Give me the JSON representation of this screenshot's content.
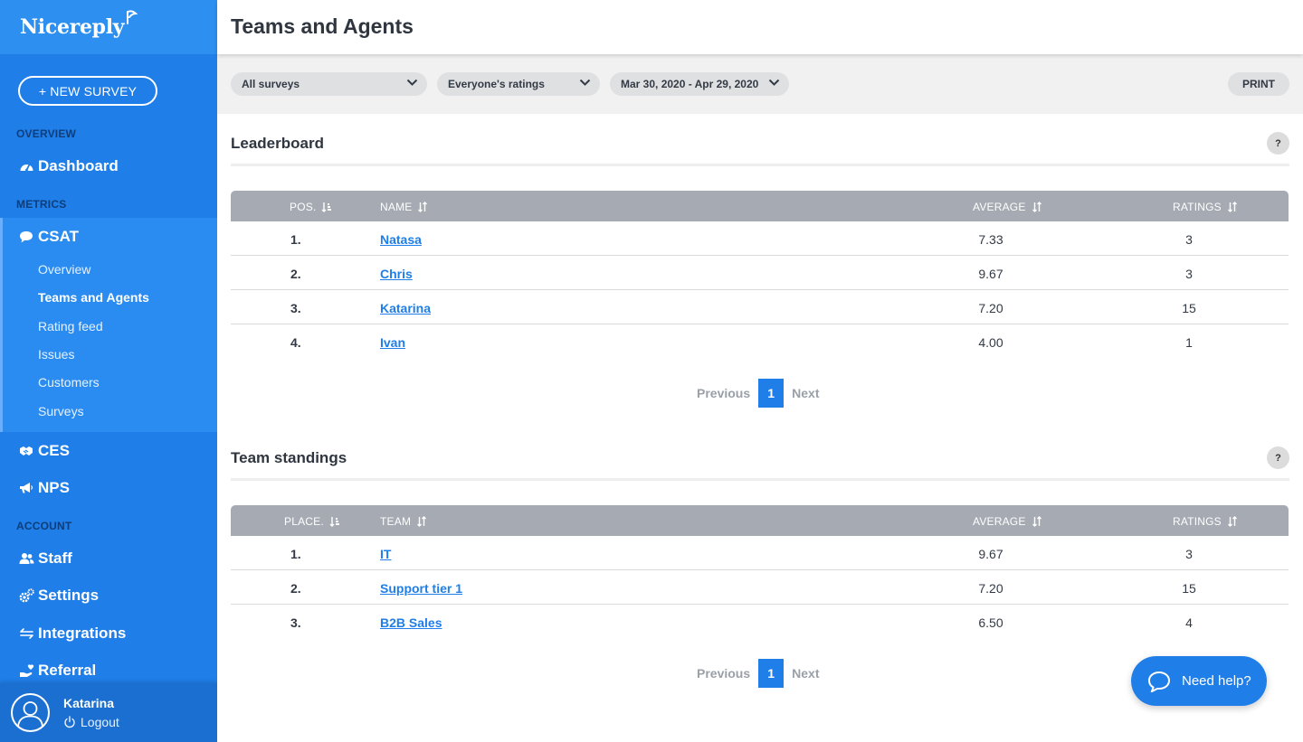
{
  "brand": {
    "name": "Nicereply"
  },
  "sidebar": {
    "new_survey_label": "+ NEW SURVEY",
    "overview_label": "OVERVIEW",
    "metrics_label": "METRICS",
    "account_label": "ACCOUNT",
    "dashboard": {
      "label": "Dashboard",
      "icon": "gauge-icon"
    },
    "csat": {
      "label": "CSAT",
      "icon": "chat-bubble-icon"
    },
    "csat_items": [
      {
        "label": "Overview",
        "active": false
      },
      {
        "label": "Teams and Agents",
        "active": true
      },
      {
        "label": "Rating feed",
        "active": false
      },
      {
        "label": "Issues",
        "active": false
      },
      {
        "label": "Customers",
        "active": false
      },
      {
        "label": "Surveys",
        "active": false
      }
    ],
    "ces": {
      "label": "CES",
      "icon": "handshake-icon"
    },
    "nps": {
      "label": "NPS",
      "icon": "megaphone-icon"
    },
    "staff": {
      "label": "Staff",
      "icon": "users-icon"
    },
    "settings": {
      "label": "Settings",
      "icon": "gears-icon"
    },
    "integrations": {
      "label": "Integrations",
      "icon": "arrows-exchange-icon"
    },
    "referral": {
      "label": "Referral",
      "icon": "hand-heart-icon"
    },
    "user": {
      "name": "Katarina",
      "logout_label": "Logout"
    }
  },
  "header": {
    "title": "Teams and Agents"
  },
  "filters": {
    "survey": "All surveys",
    "ratings": "Everyone's ratings",
    "date_range": "Mar 30, 2020 - Apr 29, 2020",
    "print_label": "PRINT"
  },
  "leaderboard": {
    "title": "Leaderboard",
    "help": "?",
    "columns": {
      "pos": "POS.",
      "name": "NAME",
      "average": "AVERAGE",
      "ratings": "RATINGS"
    },
    "rows": [
      {
        "pos": "1.",
        "name": "Natasa",
        "average": "7.33",
        "ratings": "3"
      },
      {
        "pos": "2.",
        "name": "Chris",
        "average": "9.67",
        "ratings": "3"
      },
      {
        "pos": "3.",
        "name": "Katarina",
        "average": "7.20",
        "ratings": "15"
      },
      {
        "pos": "4.",
        "name": "Ivan",
        "average": "4.00",
        "ratings": "1"
      }
    ],
    "pager": {
      "previous": "Previous",
      "page": "1",
      "next": "Next"
    }
  },
  "team_standings": {
    "title": "Team standings",
    "help": "?",
    "columns": {
      "place": "PLACE.",
      "team": "TEAM",
      "average": "AVERAGE",
      "ratings": "RATINGS"
    },
    "rows": [
      {
        "pos": "1.",
        "name": "IT",
        "average": "9.67",
        "ratings": "3"
      },
      {
        "pos": "2.",
        "name": "Support tier 1",
        "average": "7.20",
        "ratings": "15"
      },
      {
        "pos": "3.",
        "name": "B2B Sales",
        "average": "6.50",
        "ratings": "4"
      }
    ],
    "pager": {
      "previous": "Previous",
      "page": "1",
      "next": "Next"
    }
  },
  "help_widget": {
    "label": "Need help?"
  },
  "colors": {
    "sidebar": "#1f7ee8",
    "accent": "#1f7ee8",
    "table_header": "#a6aab2",
    "filter_bar": "#f1f1f1"
  }
}
